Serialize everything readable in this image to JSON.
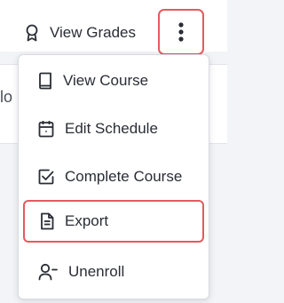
{
  "header": {
    "view_grades_label": "View Grades",
    "view_grades_icon": "award-ribbon-icon",
    "more_menu_icon": "vertical-ellipsis-icon"
  },
  "background": {
    "partial_text": "lo"
  },
  "menu": {
    "items": [
      {
        "label": "View Course",
        "icon": "book-icon"
      },
      {
        "label": "Edit Schedule",
        "icon": "calendar-icon"
      },
      {
        "label": "Complete Course",
        "icon": "checkbox-icon"
      },
      {
        "label": "Export",
        "icon": "file-text-icon"
      },
      {
        "label": "Unenroll",
        "icon": "user-minus-icon"
      }
    ]
  },
  "colors": {
    "highlight": "#e45a5f",
    "text": "#2a2d35"
  }
}
